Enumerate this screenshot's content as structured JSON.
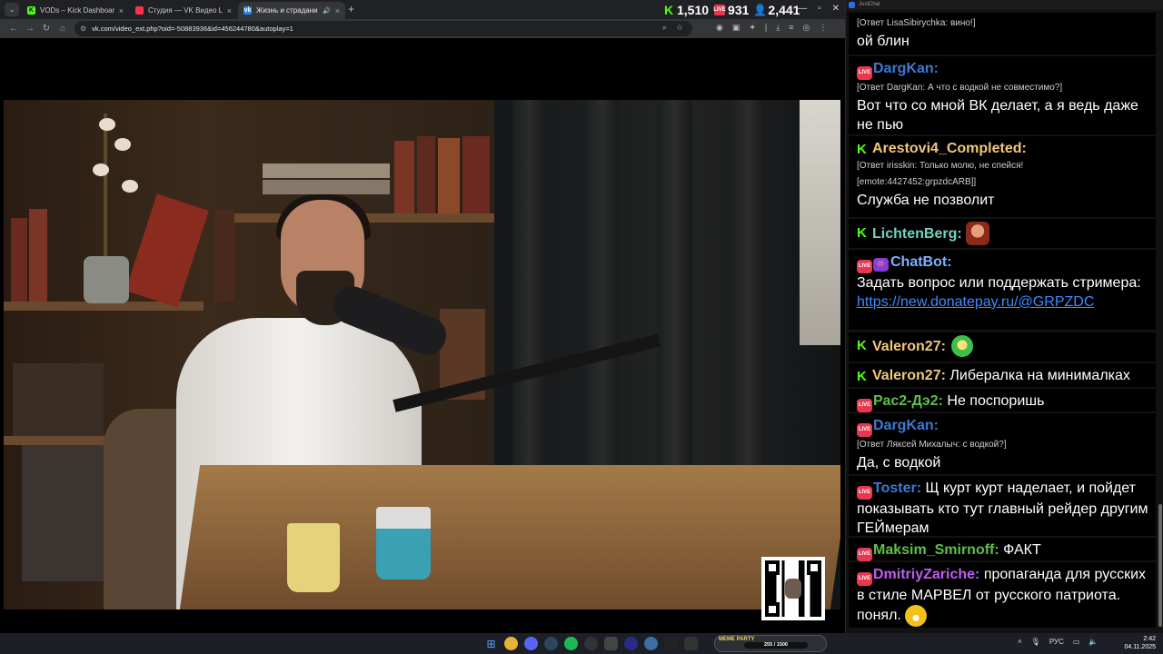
{
  "browser": {
    "tabs": [
      {
        "title": "VODs – Kick Dashboard",
        "favicon_color": "#53fc18"
      },
      {
        "title": "Студия — VK Видео Live",
        "favicon_color": "#ff3347"
      },
      {
        "title": "Жизнь и страдания Рома…",
        "favicon_color": "#2787f5"
      }
    ],
    "stats": {
      "kick": "1,510",
      "live": "931",
      "viewers": "2,441"
    },
    "url": "vk.com/video_ext.php?oid=-50883936&id=456244780&autoplay=1"
  },
  "chat": {
    "window_title": "JustChat",
    "messages": [
      {
        "reply": "[Ответ LisaSibirychka: вино!]",
        "text": "ой блин"
      },
      {
        "badge": "live",
        "nick": "DargKan:",
        "nick_color": "#3b7bd4",
        "reply": "[Ответ DargKan: А что с водкой не совместимо?]",
        "text": "Вот что со мной ВК делает, а я ведь даже не пью"
      },
      {
        "badge": "kick",
        "nick": "Arestovi4_Completed:",
        "nick_color": "#f3c77a",
        "reply": "[Ответ irisskin: Только молю, не спейся!",
        "reply2": "[emote:4427452:grpzdcARB]]",
        "text": "Служба не позволит"
      },
      {
        "badge": "kick",
        "nick": "LichtenBerg:",
        "nick_color": "#6fd3c0",
        "emote": "lichtenberg-emote"
      },
      {
        "badge": "live",
        "nick": "ChatBot:",
        "nick_color": "#7fb0ff",
        "text": "Задать вопрос или поддержать стримера:",
        "link": "https://new.donatepay.ru/@GRPZDC"
      },
      {
        "badge": "kick",
        "nick": "Valeron27:",
        "nick_color": "#f3c77a",
        "emote": "valeron-emote"
      },
      {
        "badge": "kick",
        "nick": "Valeron27:",
        "nick_color": "#f3c77a",
        "text": "Либералка на минималках"
      },
      {
        "badge": "live",
        "nick": "Рас2-Дэ2:",
        "nick_color": "#5fbf4c",
        "text": "Не поспоришь"
      },
      {
        "badge": "live",
        "nick": "DargKan:",
        "nick_color": "#3b7bd4",
        "reply": "[Ответ Ляксей Михалыч: с водкой?]",
        "text": "Да, с водкой"
      },
      {
        "badge": "live",
        "nick": "Toster:",
        "nick_color": "#3b7bd4",
        "text": "Щ курт курт наделает, и пойдет показывать кто тут главный рейдер другим ГЕЙмерам"
      },
      {
        "badge": "live",
        "nick": "Maksim_Smirnoff:",
        "nick_color": "#5fbf4c",
        "text": "ФАКТ"
      },
      {
        "badge": "live",
        "nick": "DmitriyZariche:",
        "nick_color": "#c25cf0",
        "text": "пропаганда для русских в стиле МАРВЕЛ от русского патриота. понял.",
        "emote": "smile-emote"
      }
    ]
  },
  "taskbar": {
    "meme_label": "MEME PARTY",
    "meme_progress": "255 / 1500",
    "lang": "РУС",
    "time": "2:42",
    "date": "04.11.2025"
  }
}
